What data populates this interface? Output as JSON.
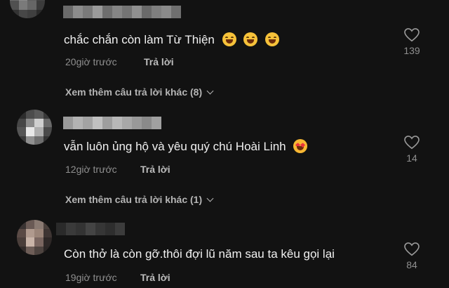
{
  "comments": [
    {
      "text": "chắc chắn còn làm Từ Thiện",
      "emojis": [
        "grinning-sweat-emoji",
        "grinning-sweat-emoji",
        "grinning-sweat-emoji"
      ],
      "time": "20giờ trước",
      "reply_label": "Trả lời",
      "likes": "139",
      "more_replies": "Xem thêm câu trả lời khác (8)"
    },
    {
      "text": "vẫn luôn ủng hộ và yêu quý chú Hoài Linh",
      "emojis": [
        "smiling-hearts-emoji"
      ],
      "time": "12giờ trước",
      "reply_label": "Trả lời",
      "likes": "14",
      "more_replies": "Xem thêm câu trả lời khác (1)"
    },
    {
      "text": "Còn thở là còn gỡ.thôi đợi lũ năm sau ta kêu gọi lại",
      "emojis": [],
      "time": "19giờ trước",
      "reply_label": "Trả lời",
      "likes": "84"
    }
  ],
  "colors": {
    "background": "#121212",
    "text": "#ededed",
    "muted": "#8f8f8f"
  },
  "icons": {
    "like": "heart-outline-icon",
    "expand": "chevron-down-icon"
  }
}
